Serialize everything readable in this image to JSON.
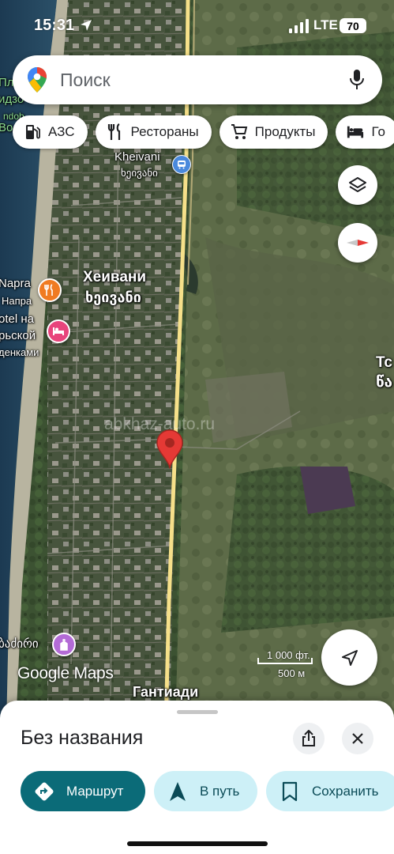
{
  "status_bar": {
    "time": "15:31",
    "network": "LTE",
    "battery": "70"
  },
  "search": {
    "placeholder": "Поиск"
  },
  "chips": [
    {
      "label": "АЗС",
      "icon": "gas-station-icon"
    },
    {
      "label": "Рестораны",
      "icon": "restaurant-icon"
    },
    {
      "label": "Продукты",
      "icon": "cart-icon"
    },
    {
      "label": "Го",
      "icon": "hotel-bed-icon"
    }
  ],
  "map": {
    "labels": {
      "kheivani_latin": "Kheivani",
      "kheivani_georgian": "ხეივანი",
      "kheivani_ru": "Хеивани",
      "kheivani_ge2": "ხეივანი",
      "napra": "Napra",
      "napra_ru": "Напра",
      "hotel_line1": "otel на",
      "hotel_line2": "рьской",
      "hotel_line3": "денками",
      "top_left1": "Пл",
      "top_left2": "идзо",
      "top_left3": "ndob",
      "top_left4": "Во",
      "right_edge1": "Тс",
      "right_edge2": "წა",
      "church": "ბაძირი",
      "gantiadi": "Гантиади",
      "watermark": "abkhaz-auto.ru"
    },
    "scale": {
      "feet": "1 000 фт.",
      "meters": "500 м"
    },
    "attribution": "Google Maps"
  },
  "sheet": {
    "title": "Без названия",
    "buttons": {
      "route": "Маршрут",
      "start": "В путь",
      "save": "Сохранить"
    }
  },
  "colors": {
    "primary": "#0b6b78",
    "secondary_bg": "#cdf0f7",
    "pin": "#e53935"
  }
}
